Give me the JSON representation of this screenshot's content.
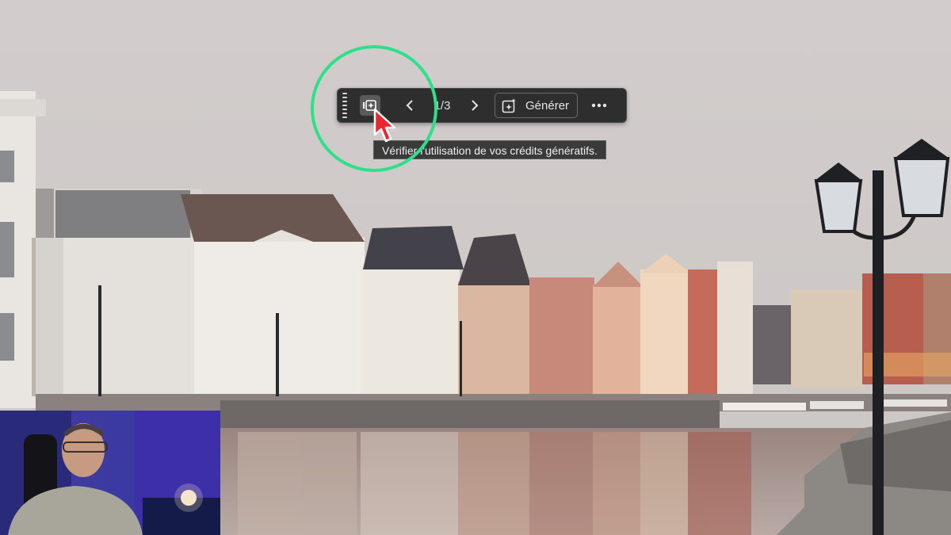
{
  "toolbar": {
    "counter": "1/3",
    "generate_label": "Générer",
    "icons": {
      "grip": "drag-handle-icon",
      "credits": "generative-credits-icon",
      "prev": "chevron-left-icon",
      "next": "chevron-right-icon",
      "generate": "generate-sparkle-icon",
      "more": "more-horizontal-icon"
    }
  },
  "tooltip": {
    "text": "Vérifier l'utilisation de vos crédits génératifs."
  },
  "colors": {
    "highlight_ring": "#2fe08a",
    "cursor": "#e8282e",
    "toolbar_bg": "#2e2e2e"
  }
}
